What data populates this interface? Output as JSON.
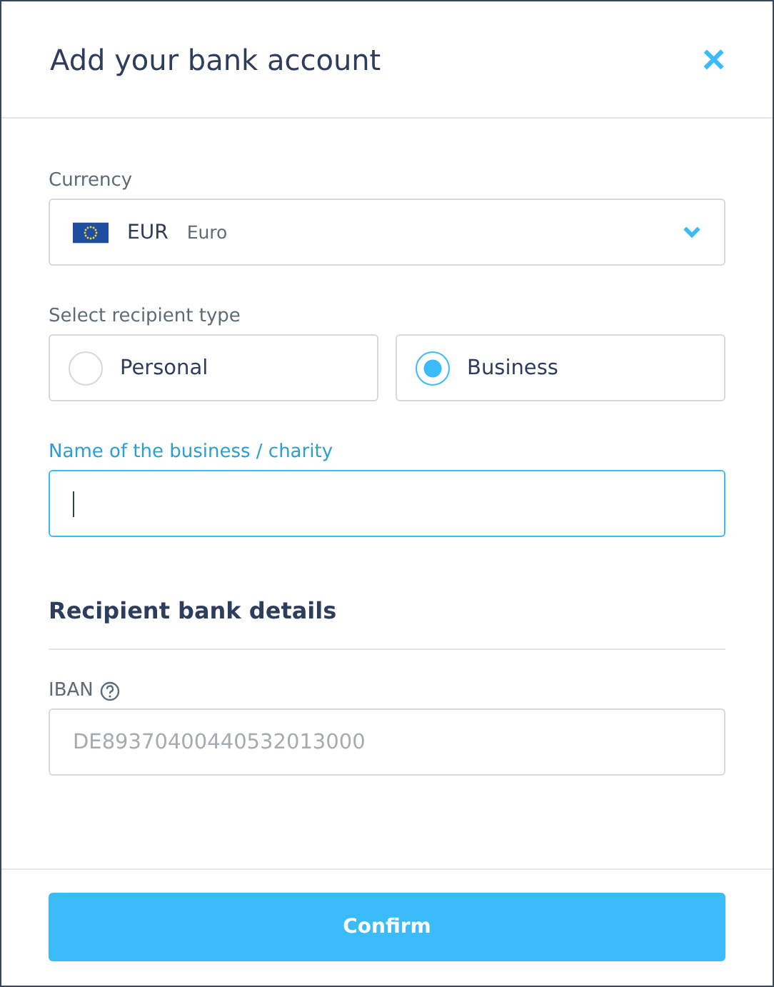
{
  "dialog": {
    "title": "Add your bank account",
    "close_label": "×"
  },
  "currency": {
    "label": "Currency",
    "code": "EUR",
    "name": "Euro"
  },
  "recipient_type": {
    "label": "Select recipient type",
    "options": [
      {
        "label": "Personal",
        "selected": false
      },
      {
        "label": "Business",
        "selected": true
      }
    ]
  },
  "business_name": {
    "label": "Name of the business / charity",
    "focused": true
  },
  "bank_details": {
    "heading": "Recipient bank details",
    "iban": {
      "label": "IBAN",
      "placeholder": "DE89370400440532013000",
      "focused": false
    }
  },
  "buttons": [
    "Confirm"
  ]
}
